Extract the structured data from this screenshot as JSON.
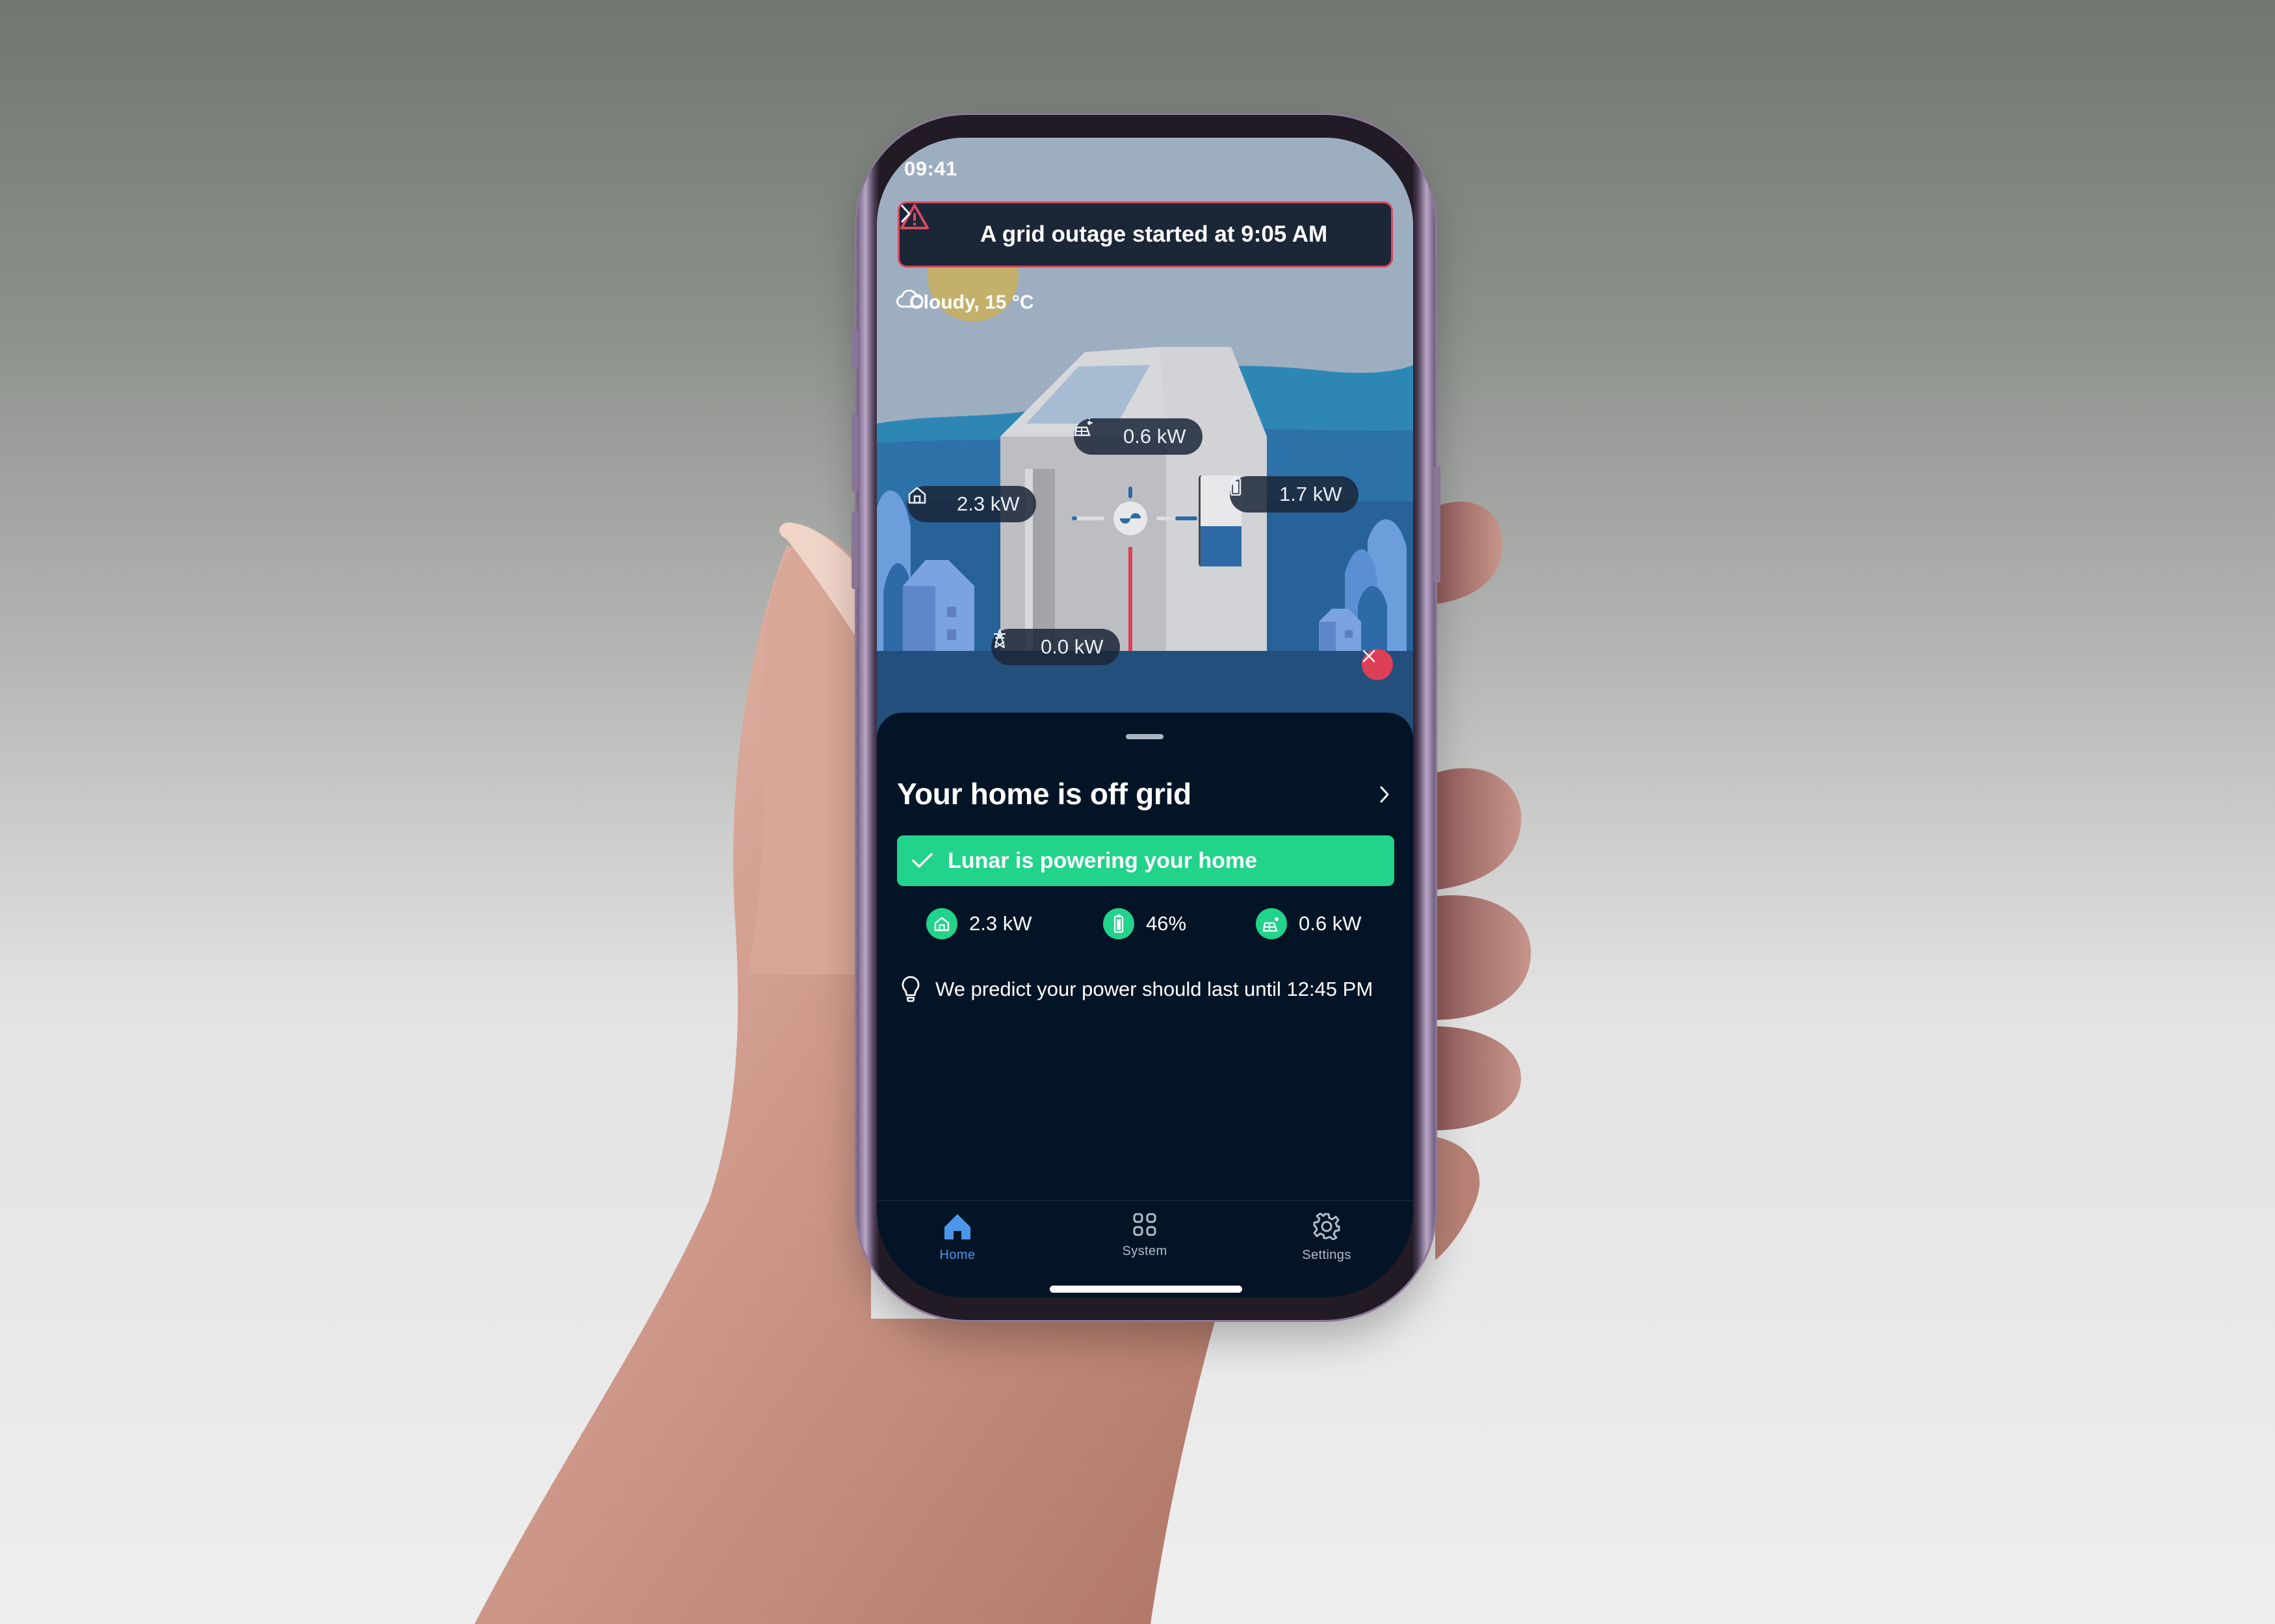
{
  "status_bar": {
    "time": "09:41",
    "focus_icon": "moon-icon",
    "signal_icon": "cellular-signal-icon",
    "wifi_icon": "wifi-icon",
    "battery_icon": "battery-icon"
  },
  "alert": {
    "icon": "warning-triangle-icon",
    "text": "A grid outage started at 9:05 AM",
    "chevron_icon": "chevron-right-icon",
    "color": "#d9495e"
  },
  "weather": {
    "icon": "cloud-icon",
    "text": "Cloudy, 15 °C"
  },
  "energy_flow": {
    "solar": {
      "icon": "solar-panel-icon",
      "value": "0.6 kW"
    },
    "home": {
      "icon": "home-icon",
      "value": "2.3 kW"
    },
    "battery": {
      "icon": "battery-icon",
      "value": "1.7 kW",
      "charge_level_percent": 46
    },
    "grid": {
      "icon": "power-pylon-icon",
      "value": "0.0 kW",
      "status": "disconnected",
      "status_icon": "close-icon"
    }
  },
  "sheet": {
    "title": "Your home is off grid",
    "status_banner": {
      "icon": "checkmark-icon",
      "text": "Lunar is powering your home",
      "color": "#22d38b"
    },
    "stats": [
      {
        "icon": "home-icon",
        "value": "2.3 kW"
      },
      {
        "icon": "battery-icon",
        "value": "46%"
      },
      {
        "icon": "solar-panel-icon",
        "value": "0.6 kW"
      }
    ],
    "prediction": {
      "icon": "lightbulb-icon",
      "text": "We predict your power should last until 12:45 PM"
    }
  },
  "tabs": [
    {
      "label": "Home",
      "icon": "home-icon",
      "active": true
    },
    {
      "label": "System",
      "icon": "grid-icon",
      "active": false
    },
    {
      "label": "Settings",
      "icon": "gear-icon",
      "active": false
    }
  ],
  "colors": {
    "accent_blue": "#4c97ea",
    "success_green": "#22d38b",
    "error_red": "#dc3f56",
    "sheet_bg": "#031426"
  }
}
